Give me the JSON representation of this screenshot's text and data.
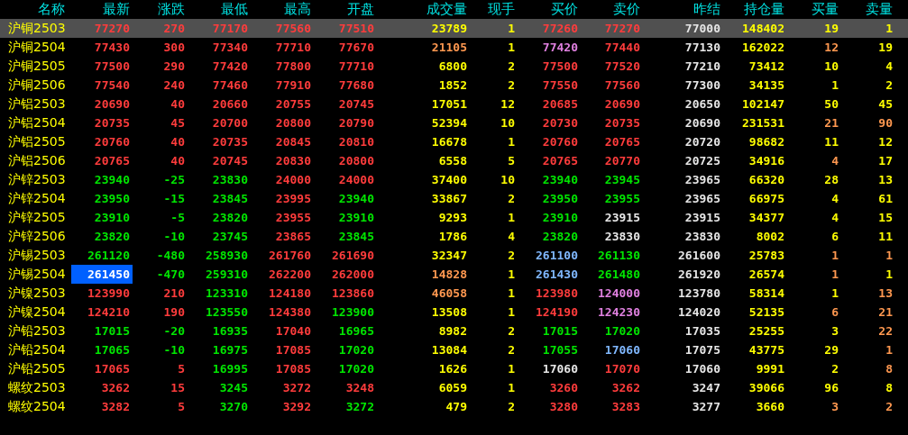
{
  "columns": [
    "名称",
    "最新",
    "涨跌",
    "最低",
    "最高",
    "开盘",
    "成交量",
    "现手",
    "买价",
    "卖价",
    "昨结",
    "持仓量",
    "买量",
    "卖量"
  ],
  "rows": [
    {
      "name": "沪铜2503",
      "selected": true,
      "flash": false,
      "cells": [
        {
          "text": "77270",
          "color": "#ff3c3c"
        },
        {
          "text": "270",
          "color": "#ff3c3c"
        },
        {
          "text": "77170",
          "color": "#ff3c3c"
        },
        {
          "text": "77560",
          "color": "#ff3c3c"
        },
        {
          "text": "77510",
          "color": "#ff3c3c"
        },
        {
          "text": "23789",
          "color": "#ffff00"
        },
        {
          "text": "1",
          "color": "#ffff00"
        },
        {
          "text": "77260",
          "color": "#ff3c3c"
        },
        {
          "text": "77270",
          "color": "#ff3c3c"
        },
        {
          "text": "77000",
          "color": "#e6e6e6"
        },
        {
          "text": "148402",
          "color": "#ffff00"
        },
        {
          "text": "19",
          "color": "#ffff00"
        },
        {
          "text": "1",
          "color": "#ffff00"
        }
      ]
    },
    {
      "name": "沪铜2504",
      "selected": false,
      "flash": false,
      "cells": [
        {
          "text": "77430",
          "color": "#ff3c3c"
        },
        {
          "text": "300",
          "color": "#ff3c3c"
        },
        {
          "text": "77340",
          "color": "#ff3c3c"
        },
        {
          "text": "77710",
          "color": "#ff3c3c"
        },
        {
          "text": "77670",
          "color": "#ff3c3c"
        },
        {
          "text": "21105",
          "color": "#ff9850"
        },
        {
          "text": "1",
          "color": "#ffff00"
        },
        {
          "text": "77420",
          "color": "#e080e0"
        },
        {
          "text": "77440",
          "color": "#ff3c3c"
        },
        {
          "text": "77130",
          "color": "#e6e6e6"
        },
        {
          "text": "162022",
          "color": "#ffff00"
        },
        {
          "text": "12",
          "color": "#ff9850"
        },
        {
          "text": "19",
          "color": "#ffff00"
        }
      ]
    },
    {
      "name": "沪铜2505",
      "selected": false,
      "flash": false,
      "cells": [
        {
          "text": "77500",
          "color": "#ff3c3c"
        },
        {
          "text": "290",
          "color": "#ff3c3c"
        },
        {
          "text": "77420",
          "color": "#ff3c3c"
        },
        {
          "text": "77800",
          "color": "#ff3c3c"
        },
        {
          "text": "77710",
          "color": "#ff3c3c"
        },
        {
          "text": "6800",
          "color": "#ffff00"
        },
        {
          "text": "2",
          "color": "#ffff00"
        },
        {
          "text": "77500",
          "color": "#ff3c3c"
        },
        {
          "text": "77520",
          "color": "#ff3c3c"
        },
        {
          "text": "77210",
          "color": "#e6e6e6"
        },
        {
          "text": "73412",
          "color": "#ffff00"
        },
        {
          "text": "10",
          "color": "#ffff00"
        },
        {
          "text": "4",
          "color": "#ffff00"
        }
      ]
    },
    {
      "name": "沪铜2506",
      "selected": false,
      "flash": false,
      "cells": [
        {
          "text": "77540",
          "color": "#ff3c3c"
        },
        {
          "text": "240",
          "color": "#ff3c3c"
        },
        {
          "text": "77460",
          "color": "#ff3c3c"
        },
        {
          "text": "77910",
          "color": "#ff3c3c"
        },
        {
          "text": "77680",
          "color": "#ff3c3c"
        },
        {
          "text": "1852",
          "color": "#ffff00"
        },
        {
          "text": "2",
          "color": "#ffff00"
        },
        {
          "text": "77550",
          "color": "#ff3c3c"
        },
        {
          "text": "77560",
          "color": "#ff3c3c"
        },
        {
          "text": "77300",
          "color": "#e6e6e6"
        },
        {
          "text": "34135",
          "color": "#ffff00"
        },
        {
          "text": "1",
          "color": "#ffff00"
        },
        {
          "text": "2",
          "color": "#ffff00"
        }
      ]
    },
    {
      "name": "沪铝2503",
      "selected": false,
      "flash": false,
      "cells": [
        {
          "text": "20690",
          "color": "#ff3c3c"
        },
        {
          "text": "40",
          "color": "#ff3c3c"
        },
        {
          "text": "20660",
          "color": "#ff3c3c"
        },
        {
          "text": "20755",
          "color": "#ff3c3c"
        },
        {
          "text": "20745",
          "color": "#ff3c3c"
        },
        {
          "text": "17051",
          "color": "#ffff00"
        },
        {
          "text": "12",
          "color": "#ffff00"
        },
        {
          "text": "20685",
          "color": "#ff3c3c"
        },
        {
          "text": "20690",
          "color": "#ff3c3c"
        },
        {
          "text": "20650",
          "color": "#e6e6e6"
        },
        {
          "text": "102147",
          "color": "#ffff00"
        },
        {
          "text": "50",
          "color": "#ffff00"
        },
        {
          "text": "45",
          "color": "#ffff00"
        }
      ]
    },
    {
      "name": "沪铝2504",
      "selected": false,
      "flash": false,
      "cells": [
        {
          "text": "20735",
          "color": "#ff3c3c"
        },
        {
          "text": "45",
          "color": "#ff3c3c"
        },
        {
          "text": "20700",
          "color": "#ff3c3c"
        },
        {
          "text": "20800",
          "color": "#ff3c3c"
        },
        {
          "text": "20790",
          "color": "#ff3c3c"
        },
        {
          "text": "52394",
          "color": "#ffff00"
        },
        {
          "text": "10",
          "color": "#ffff00"
        },
        {
          "text": "20730",
          "color": "#ff3c3c"
        },
        {
          "text": "20735",
          "color": "#ff3c3c"
        },
        {
          "text": "20690",
          "color": "#e6e6e6"
        },
        {
          "text": "231531",
          "color": "#ffff00"
        },
        {
          "text": "21",
          "color": "#ff9850"
        },
        {
          "text": "90",
          "color": "#ff9850"
        }
      ]
    },
    {
      "name": "沪铝2505",
      "selected": false,
      "flash": false,
      "cells": [
        {
          "text": "20760",
          "color": "#ff3c3c"
        },
        {
          "text": "40",
          "color": "#ff3c3c"
        },
        {
          "text": "20735",
          "color": "#ff3c3c"
        },
        {
          "text": "20845",
          "color": "#ff3c3c"
        },
        {
          "text": "20810",
          "color": "#ff3c3c"
        },
        {
          "text": "16678",
          "color": "#ffff00"
        },
        {
          "text": "1",
          "color": "#ffff00"
        },
        {
          "text": "20760",
          "color": "#ff3c3c"
        },
        {
          "text": "20765",
          "color": "#ff3c3c"
        },
        {
          "text": "20720",
          "color": "#e6e6e6"
        },
        {
          "text": "98682",
          "color": "#ffff00"
        },
        {
          "text": "11",
          "color": "#ffff00"
        },
        {
          "text": "12",
          "color": "#ffff00"
        }
      ]
    },
    {
      "name": "沪铝2506",
      "selected": false,
      "flash": false,
      "cells": [
        {
          "text": "20765",
          "color": "#ff3c3c"
        },
        {
          "text": "40",
          "color": "#ff3c3c"
        },
        {
          "text": "20745",
          "color": "#ff3c3c"
        },
        {
          "text": "20830",
          "color": "#ff3c3c"
        },
        {
          "text": "20800",
          "color": "#ff3c3c"
        },
        {
          "text": "6558",
          "color": "#ffff00"
        },
        {
          "text": "5",
          "color": "#ffff00"
        },
        {
          "text": "20765",
          "color": "#ff3c3c"
        },
        {
          "text": "20770",
          "color": "#ff3c3c"
        },
        {
          "text": "20725",
          "color": "#e6e6e6"
        },
        {
          "text": "34916",
          "color": "#ffff00"
        },
        {
          "text": "4",
          "color": "#ff9850"
        },
        {
          "text": "17",
          "color": "#ffff00"
        }
      ]
    },
    {
      "name": "沪锌2503",
      "selected": false,
      "flash": false,
      "cells": [
        {
          "text": "23940",
          "color": "#00e600"
        },
        {
          "text": "-25",
          "color": "#00e600"
        },
        {
          "text": "23830",
          "color": "#00e600"
        },
        {
          "text": "24000",
          "color": "#ff3c3c"
        },
        {
          "text": "24000",
          "color": "#ff3c3c"
        },
        {
          "text": "37400",
          "color": "#ffff00"
        },
        {
          "text": "10",
          "color": "#ffff00"
        },
        {
          "text": "23940",
          "color": "#00e600"
        },
        {
          "text": "23945",
          "color": "#00e600"
        },
        {
          "text": "23965",
          "color": "#e6e6e6"
        },
        {
          "text": "66320",
          "color": "#ffff00"
        },
        {
          "text": "28",
          "color": "#ffff00"
        },
        {
          "text": "13",
          "color": "#ffff00"
        }
      ]
    },
    {
      "name": "沪锌2504",
      "selected": false,
      "flash": false,
      "cells": [
        {
          "text": "23950",
          "color": "#00e600"
        },
        {
          "text": "-15",
          "color": "#00e600"
        },
        {
          "text": "23845",
          "color": "#00e600"
        },
        {
          "text": "23995",
          "color": "#ff3c3c"
        },
        {
          "text": "23940",
          "color": "#00e600"
        },
        {
          "text": "33867",
          "color": "#ffff00"
        },
        {
          "text": "2",
          "color": "#ffff00"
        },
        {
          "text": "23950",
          "color": "#00e600"
        },
        {
          "text": "23955",
          "color": "#00e600"
        },
        {
          "text": "23965",
          "color": "#e6e6e6"
        },
        {
          "text": "66975",
          "color": "#ffff00"
        },
        {
          "text": "4",
          "color": "#ffff00"
        },
        {
          "text": "61",
          "color": "#ffff00"
        }
      ]
    },
    {
      "name": "沪锌2505",
      "selected": false,
      "flash": false,
      "cells": [
        {
          "text": "23910",
          "color": "#00e600"
        },
        {
          "text": "-5",
          "color": "#00e600"
        },
        {
          "text": "23820",
          "color": "#00e600"
        },
        {
          "text": "23955",
          "color": "#ff3c3c"
        },
        {
          "text": "23910",
          "color": "#00e600"
        },
        {
          "text": "9293",
          "color": "#ffff00"
        },
        {
          "text": "1",
          "color": "#ffff00"
        },
        {
          "text": "23910",
          "color": "#00e600"
        },
        {
          "text": "23915",
          "color": "#e6e6e6"
        },
        {
          "text": "23915",
          "color": "#e6e6e6"
        },
        {
          "text": "34377",
          "color": "#ffff00"
        },
        {
          "text": "4",
          "color": "#ffff00"
        },
        {
          "text": "15",
          "color": "#ffff00"
        }
      ]
    },
    {
      "name": "沪锌2506",
      "selected": false,
      "flash": false,
      "cells": [
        {
          "text": "23820",
          "color": "#00e600"
        },
        {
          "text": "-10",
          "color": "#00e600"
        },
        {
          "text": "23745",
          "color": "#00e600"
        },
        {
          "text": "23865",
          "color": "#ff3c3c"
        },
        {
          "text": "23845",
          "color": "#00e600"
        },
        {
          "text": "1786",
          "color": "#ffff00"
        },
        {
          "text": "4",
          "color": "#ffff00"
        },
        {
          "text": "23820",
          "color": "#00e600"
        },
        {
          "text": "23830",
          "color": "#e6e6e6"
        },
        {
          "text": "23830",
          "color": "#e6e6e6"
        },
        {
          "text": "8002",
          "color": "#ffff00"
        },
        {
          "text": "6",
          "color": "#ffff00"
        },
        {
          "text": "11",
          "color": "#ffff00"
        }
      ]
    },
    {
      "name": "沪锡2503",
      "selected": false,
      "flash": false,
      "cells": [
        {
          "text": "261120",
          "color": "#00e600"
        },
        {
          "text": "-480",
          "color": "#00e600"
        },
        {
          "text": "258930",
          "color": "#00e600"
        },
        {
          "text": "261760",
          "color": "#ff3c3c"
        },
        {
          "text": "261690",
          "color": "#ff3c3c"
        },
        {
          "text": "32347",
          "color": "#ffff00"
        },
        {
          "text": "2",
          "color": "#ffff00"
        },
        {
          "text": "261100",
          "color": "#80b8ff"
        },
        {
          "text": "261130",
          "color": "#00e600"
        },
        {
          "text": "261600",
          "color": "#e6e6e6"
        },
        {
          "text": "25783",
          "color": "#ffff00"
        },
        {
          "text": "1",
          "color": "#ff9850"
        },
        {
          "text": "1",
          "color": "#ff9850"
        }
      ]
    },
    {
      "name": "沪锡2504",
      "selected": false,
      "flash": true,
      "cells": [
        {
          "text": "261450",
          "color": "#ffffff"
        },
        {
          "text": "-470",
          "color": "#00e600"
        },
        {
          "text": "259310",
          "color": "#00e600"
        },
        {
          "text": "262200",
          "color": "#ff3c3c"
        },
        {
          "text": "262000",
          "color": "#ff3c3c"
        },
        {
          "text": "14828",
          "color": "#ff9850"
        },
        {
          "text": "1",
          "color": "#ffff00"
        },
        {
          "text": "261430",
          "color": "#80b8ff"
        },
        {
          "text": "261480",
          "color": "#00e600"
        },
        {
          "text": "261920",
          "color": "#e6e6e6"
        },
        {
          "text": "26574",
          "color": "#ffff00"
        },
        {
          "text": "1",
          "color": "#ff9850"
        },
        {
          "text": "1",
          "color": "#ffff00"
        }
      ]
    },
    {
      "name": "沪镍2503",
      "selected": false,
      "flash": false,
      "cells": [
        {
          "text": "123990",
          "color": "#ff3c3c"
        },
        {
          "text": "210",
          "color": "#ff3c3c"
        },
        {
          "text": "123310",
          "color": "#00e600"
        },
        {
          "text": "124180",
          "color": "#ff3c3c"
        },
        {
          "text": "123860",
          "color": "#ff3c3c"
        },
        {
          "text": "46058",
          "color": "#ff9850"
        },
        {
          "text": "1",
          "color": "#ffff00"
        },
        {
          "text": "123980",
          "color": "#ff3c3c"
        },
        {
          "text": "124000",
          "color": "#e080e0"
        },
        {
          "text": "123780",
          "color": "#e6e6e6"
        },
        {
          "text": "58314",
          "color": "#ffff00"
        },
        {
          "text": "1",
          "color": "#ffff00"
        },
        {
          "text": "13",
          "color": "#ff9850"
        }
      ]
    },
    {
      "name": "沪镍2504",
      "selected": false,
      "flash": false,
      "cells": [
        {
          "text": "124210",
          "color": "#ff3c3c"
        },
        {
          "text": "190",
          "color": "#ff3c3c"
        },
        {
          "text": "123550",
          "color": "#00e600"
        },
        {
          "text": "124380",
          "color": "#ff3c3c"
        },
        {
          "text": "123900",
          "color": "#00e600"
        },
        {
          "text": "13508",
          "color": "#ffff00"
        },
        {
          "text": "1",
          "color": "#ffff00"
        },
        {
          "text": "124190",
          "color": "#ff3c3c"
        },
        {
          "text": "124230",
          "color": "#e080e0"
        },
        {
          "text": "124020",
          "color": "#e6e6e6"
        },
        {
          "text": "52135",
          "color": "#ffff00"
        },
        {
          "text": "6",
          "color": "#ff9850"
        },
        {
          "text": "21",
          "color": "#ff9850"
        }
      ]
    },
    {
      "name": "沪铅2503",
      "selected": false,
      "flash": false,
      "cells": [
        {
          "text": "17015",
          "color": "#00e600"
        },
        {
          "text": "-20",
          "color": "#00e600"
        },
        {
          "text": "16935",
          "color": "#00e600"
        },
        {
          "text": "17040",
          "color": "#ff3c3c"
        },
        {
          "text": "16965",
          "color": "#00e600"
        },
        {
          "text": "8982",
          "color": "#ffff00"
        },
        {
          "text": "2",
          "color": "#ffff00"
        },
        {
          "text": "17015",
          "color": "#00e600"
        },
        {
          "text": "17020",
          "color": "#00e600"
        },
        {
          "text": "17035",
          "color": "#e6e6e6"
        },
        {
          "text": "25255",
          "color": "#ffff00"
        },
        {
          "text": "3",
          "color": "#ffff00"
        },
        {
          "text": "22",
          "color": "#ff9850"
        }
      ]
    },
    {
      "name": "沪铅2504",
      "selected": false,
      "flash": false,
      "cells": [
        {
          "text": "17065",
          "color": "#00e600"
        },
        {
          "text": "-10",
          "color": "#00e600"
        },
        {
          "text": "16975",
          "color": "#00e600"
        },
        {
          "text": "17085",
          "color": "#ff3c3c"
        },
        {
          "text": "17020",
          "color": "#00e600"
        },
        {
          "text": "13084",
          "color": "#ffff00"
        },
        {
          "text": "2",
          "color": "#ffff00"
        },
        {
          "text": "17055",
          "color": "#00e600"
        },
        {
          "text": "17060",
          "color": "#80b8ff"
        },
        {
          "text": "17075",
          "color": "#e6e6e6"
        },
        {
          "text": "43775",
          "color": "#ffff00"
        },
        {
          "text": "29",
          "color": "#ffff00"
        },
        {
          "text": "1",
          "color": "#ff9850"
        }
      ]
    },
    {
      "name": "沪铅2505",
      "selected": false,
      "flash": false,
      "cells": [
        {
          "text": "17065",
          "color": "#ff3c3c"
        },
        {
          "text": "5",
          "color": "#ff3c3c"
        },
        {
          "text": "16995",
          "color": "#00e600"
        },
        {
          "text": "17085",
          "color": "#ff3c3c"
        },
        {
          "text": "17020",
          "color": "#00e600"
        },
        {
          "text": "1626",
          "color": "#ffff00"
        },
        {
          "text": "1",
          "color": "#ffff00"
        },
        {
          "text": "17060",
          "color": "#e6e6e6"
        },
        {
          "text": "17070",
          "color": "#ff3c3c"
        },
        {
          "text": "17060",
          "color": "#e6e6e6"
        },
        {
          "text": "9991",
          "color": "#ffff00"
        },
        {
          "text": "2",
          "color": "#ffff00"
        },
        {
          "text": "8",
          "color": "#ff9850"
        }
      ]
    },
    {
      "name": "螺纹2503",
      "selected": false,
      "flash": false,
      "cells": [
        {
          "text": "3262",
          "color": "#ff3c3c"
        },
        {
          "text": "15",
          "color": "#ff3c3c"
        },
        {
          "text": "3245",
          "color": "#00e600"
        },
        {
          "text": "3272",
          "color": "#ff3c3c"
        },
        {
          "text": "3248",
          "color": "#ff3c3c"
        },
        {
          "text": "6059",
          "color": "#ffff00"
        },
        {
          "text": "1",
          "color": "#ffff00"
        },
        {
          "text": "3260",
          "color": "#ff3c3c"
        },
        {
          "text": "3262",
          "color": "#ff3c3c"
        },
        {
          "text": "3247",
          "color": "#e6e6e6"
        },
        {
          "text": "39066",
          "color": "#ffff00"
        },
        {
          "text": "96",
          "color": "#ffff00"
        },
        {
          "text": "8",
          "color": "#ffff00"
        }
      ]
    },
    {
      "name": "螺纹2504",
      "selected": false,
      "flash": false,
      "cells": [
        {
          "text": "3282",
          "color": "#ff3c3c"
        },
        {
          "text": "5",
          "color": "#ff3c3c"
        },
        {
          "text": "3270",
          "color": "#00e600"
        },
        {
          "text": "3292",
          "color": "#ff3c3c"
        },
        {
          "text": "3272",
          "color": "#00e600"
        },
        {
          "text": "479",
          "color": "#ffff00"
        },
        {
          "text": "2",
          "color": "#ffff00"
        },
        {
          "text": "3280",
          "color": "#ff3c3c"
        },
        {
          "text": "3283",
          "color": "#ff3c3c"
        },
        {
          "text": "3277",
          "color": "#e6e6e6"
        },
        {
          "text": "3660",
          "color": "#ffff00"
        },
        {
          "text": "3",
          "color": "#ff9850"
        },
        {
          "text": "2",
          "color": "#ff9850"
        }
      ]
    }
  ]
}
